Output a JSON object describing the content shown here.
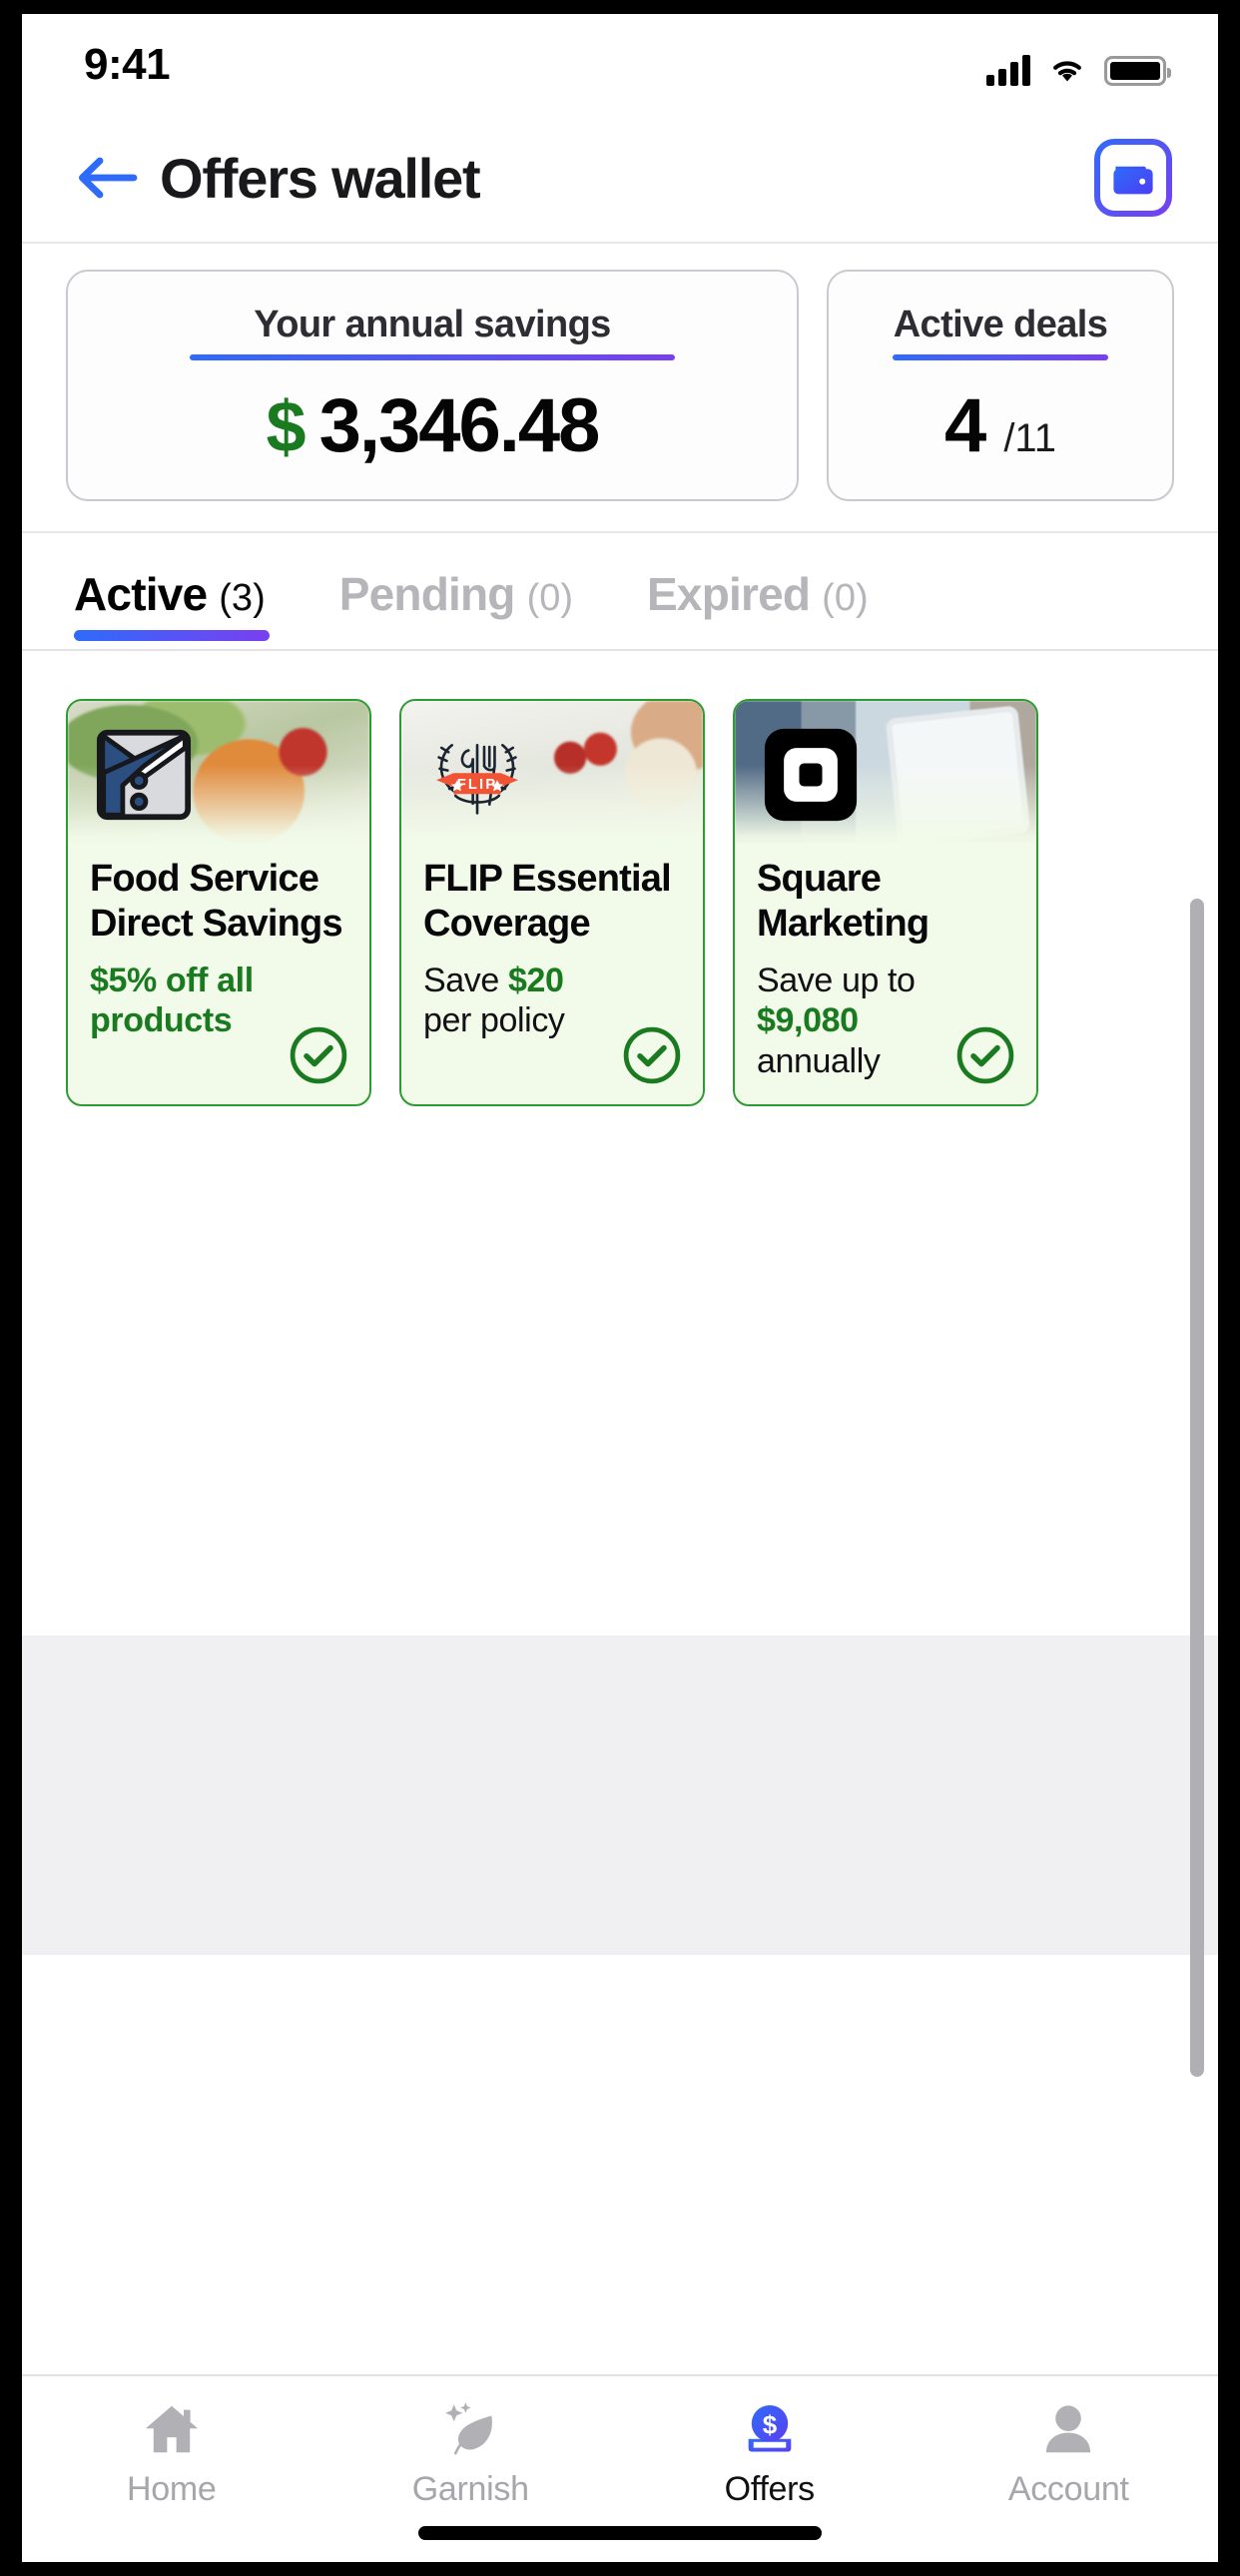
{
  "status_bar": {
    "time": "9:41",
    "signal_icon": "cellular-signal-icon",
    "wifi_icon": "wifi-icon",
    "battery_icon": "battery-full-icon"
  },
  "header": {
    "back_icon": "back-arrow-icon",
    "title": "Offers wallet",
    "wallet_icon": "wallet-icon"
  },
  "stats": {
    "savings": {
      "label": "Your annual savings",
      "currency": "$",
      "amount": "3,346.48"
    },
    "deals": {
      "label": "Active deals",
      "count": "4",
      "total": "/11"
    }
  },
  "tabs": [
    {
      "label": "Active",
      "count": "(3)",
      "active": true
    },
    {
      "label": "Pending",
      "count": "(0)",
      "active": false
    },
    {
      "label": "Expired",
      "count": "(0)",
      "active": false
    }
  ],
  "offers": [
    {
      "title": "Food Service Direct Savings",
      "subtitle_full": "$5% off all products",
      "subtitle_prefix": "",
      "subtitle_highlight": "$5% off all products",
      "subtitle_suffix": "",
      "logo_icon": "food-service-direct-logo-icon",
      "status_icon": "check-circle-icon"
    },
    {
      "title": "FLIP Essential Coverage",
      "subtitle_full": "Save $20 per policy",
      "subtitle_prefix": "Save ",
      "subtitle_highlight": "$20",
      "subtitle_suffix": " per policy",
      "logo_icon": "flip-logo-icon",
      "status_icon": "check-circle-icon"
    },
    {
      "title": "Square Marketing",
      "subtitle_full": "Save up to $9,080 annually",
      "subtitle_prefix": "Save up to ",
      "subtitle_highlight": "$9,080",
      "subtitle_suffix": " annually",
      "logo_icon": "square-logo-icon",
      "status_icon": "check-circle-icon"
    }
  ],
  "bottom_nav": [
    {
      "label": "Home",
      "icon": "home-icon",
      "active": false
    },
    {
      "label": "Garnish",
      "icon": "leaf-sparkle-icon",
      "active": false
    },
    {
      "label": "Offers",
      "icon": "offers-coin-icon",
      "active": true
    },
    {
      "label": "Account",
      "icon": "person-icon",
      "active": false
    }
  ],
  "colors": {
    "accent_blue": "#2f6bfa",
    "accent_purple": "#7a3ff0",
    "success_green": "#1a7a20",
    "card_border_green": "#2f9a33",
    "card_bg_green": "#f2fae9",
    "muted_gray": "#a6a6ab"
  }
}
